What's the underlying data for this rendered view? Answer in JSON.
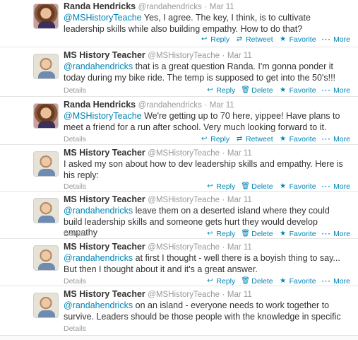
{
  "tweets": [
    {
      "avatar": "randa",
      "name": "Randa Hendricks",
      "handle": "@randahendricks",
      "time": "Mar 11",
      "mention": "@MSHistoryTeache",
      "text": " Yes, I agree. The key, I think, is to cultivate leadership skills while also building empathy. How to do that?",
      "details": "",
      "own": false
    },
    {
      "avatar": "mshist",
      "name": "MS History Teacher",
      "handle": "@MSHistoryTeache",
      "time": "Mar 11",
      "mention": "@randahendricks",
      "text": " that is a great question Randa. I'm gonna ponder it today during my bike ride. The temp is supposed to get into the 50's!!!",
      "details": "Details",
      "own": true
    },
    {
      "avatar": "randa",
      "name": "Randa Hendricks",
      "handle": "@randahendricks",
      "time": "Mar 11",
      "mention": "@MSHistoryTeache",
      "text": " We're getting up to 70 here, yippee!  Have plans to meet a friend for a run after school. Very much looking forward to it.",
      "details": "Details",
      "own": false
    },
    {
      "avatar": "mshist",
      "name": "MS History Teacher",
      "handle": "@MSHistoryTeache",
      "time": "Mar 11",
      "mention": "",
      "text": "I asked my son about how to dev leadership skills and empathy. Here is his reply:",
      "details": "Details",
      "own": true
    },
    {
      "avatar": "mshist",
      "name": "MS History Teacher",
      "handle": "@MSHistoryTeache",
      "time": "Mar 11",
      "mention": "@randahendricks",
      "text": " leave them on a deserted island where they could build leadership skills and someone gets hurt they would develop empathy",
      "details": "Details",
      "own": true
    },
    {
      "avatar": "mshist",
      "name": "MS History Teacher",
      "handle": "@MSHistoryTeache",
      "time": "Mar 11",
      "mention": "@randahendricks",
      "text": " at first I thought - well there is a boyish thing to say... But then I thought about it and it's a great answer.",
      "details": "Details",
      "own": true
    },
    {
      "avatar": "mshist",
      "name": "MS History Teacher",
      "handle": "@MSHistoryTeache",
      "time": "Mar 11",
      "mention": "@randahendricks",
      "text": " on an island - everyone needs to work together to survive. Leaders should be those people with the knowledge in specific",
      "details": "Details",
      "own": true
    }
  ],
  "actions": {
    "reply": "Reply",
    "retweet": "Retweet",
    "delete": "Delete",
    "favorite": "Favorite",
    "more": "More"
  },
  "icons": {
    "reply": "reply-arrow-icon",
    "retweet": "retweet-icon",
    "delete": "trash-icon",
    "favorite": "star-icon",
    "more": "ellipsis-icon"
  },
  "colors": {
    "link": "#0084b4",
    "muted": "#999999",
    "text": "#333333"
  }
}
